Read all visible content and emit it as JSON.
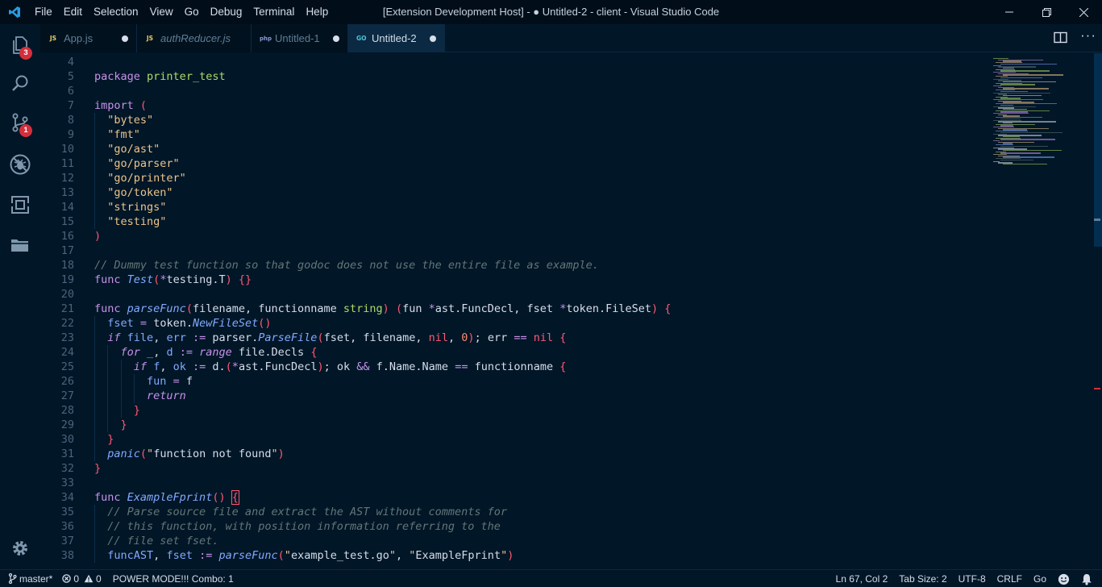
{
  "window": {
    "title": "[Extension Development Host] - ● Untitled-2 - client - Visual Studio Code",
    "menu": [
      "File",
      "Edit",
      "Selection",
      "View",
      "Go",
      "Debug",
      "Terminal",
      "Help"
    ]
  },
  "activity_bar": {
    "items": [
      {
        "name": "explorer-icon",
        "badge": "3"
      },
      {
        "name": "search-icon",
        "badge": ""
      },
      {
        "name": "source-control-icon",
        "badge": "1"
      },
      {
        "name": "debug-icon",
        "badge": ""
      },
      {
        "name": "extensions-icon",
        "badge": ""
      },
      {
        "name": "folders-icon",
        "badge": ""
      }
    ],
    "manage_icon": "gear-icon"
  },
  "tabs": [
    {
      "label": "App.js",
      "icon": "JS",
      "icon_color": "#e6cd69",
      "italic": false,
      "active": false,
      "dirty": true
    },
    {
      "label": "authReducer.js",
      "icon": "JS",
      "icon_color": "#e6cd69",
      "italic": true,
      "active": false,
      "dirty": false
    },
    {
      "label": "Untitled-1",
      "icon": "php",
      "icon_color": "#8a9ad6",
      "italic": false,
      "active": false,
      "dirty": true
    },
    {
      "label": "Untitled-2",
      "icon": "GO",
      "icon_color": "#4fc1d9",
      "italic": false,
      "active": true,
      "dirty": true
    }
  ],
  "editor": {
    "language": "Go",
    "lines": [
      {
        "n": "4",
        "indent": 0,
        "tokens": []
      },
      {
        "n": "5",
        "indent": 0,
        "tokens": [
          [
            "kw",
            "package"
          ],
          [
            "var",
            " "
          ],
          [
            "pkg",
            "printer_test"
          ]
        ]
      },
      {
        "n": "6",
        "indent": 0,
        "tokens": []
      },
      {
        "n": "7",
        "indent": 0,
        "tokens": [
          [
            "kw",
            "import"
          ],
          [
            "var",
            " "
          ],
          [
            "br",
            "("
          ]
        ]
      },
      {
        "n": "8",
        "indent": 1,
        "tokens": [
          [
            "str",
            "  \"bytes\""
          ]
        ]
      },
      {
        "n": "9",
        "indent": 1,
        "tokens": [
          [
            "str",
            "  \"fmt\""
          ]
        ]
      },
      {
        "n": "10",
        "indent": 1,
        "tokens": [
          [
            "str",
            "  \"go/ast\""
          ]
        ]
      },
      {
        "n": "11",
        "indent": 1,
        "tokens": [
          [
            "str",
            "  \"go/parser\""
          ]
        ]
      },
      {
        "n": "12",
        "indent": 1,
        "tokens": [
          [
            "str",
            "  \"go/printer\""
          ]
        ]
      },
      {
        "n": "13",
        "indent": 1,
        "tokens": [
          [
            "str",
            "  \"go/token\""
          ]
        ]
      },
      {
        "n": "14",
        "indent": 1,
        "tokens": [
          [
            "str",
            "  \"strings\""
          ]
        ]
      },
      {
        "n": "15",
        "indent": 1,
        "tokens": [
          [
            "str",
            "  \"testing\""
          ]
        ]
      },
      {
        "n": "16",
        "indent": 0,
        "tokens": [
          [
            "br",
            ")"
          ]
        ]
      },
      {
        "n": "17",
        "indent": 0,
        "tokens": []
      },
      {
        "n": "18",
        "indent": 0,
        "tokens": [
          [
            "cm",
            "// Dummy test function so that godoc does not use the entire file as example."
          ]
        ]
      },
      {
        "n": "19",
        "indent": 0,
        "tokens": [
          [
            "kw",
            "func"
          ],
          [
            "var",
            " "
          ],
          [
            "fn",
            "Test"
          ],
          [
            "br",
            "("
          ],
          [
            "op",
            "*"
          ],
          [
            "var",
            "testing.T"
          ],
          [
            "br",
            ")"
          ],
          [
            "var",
            " "
          ],
          [
            "br",
            "{}"
          ]
        ]
      },
      {
        "n": "20",
        "indent": 0,
        "tokens": []
      },
      {
        "n": "21",
        "indent": 0,
        "tokens": [
          [
            "kw",
            "func"
          ],
          [
            "var",
            " "
          ],
          [
            "fn",
            "parseFunc"
          ],
          [
            "br",
            "("
          ],
          [
            "var",
            "filename, functionname "
          ],
          [
            "type",
            "string"
          ],
          [
            "br",
            ")"
          ],
          [
            "var",
            " "
          ],
          [
            "br",
            "("
          ],
          [
            "var",
            "fun "
          ],
          [
            "op",
            "*"
          ],
          [
            "var",
            "ast.FuncDecl, fset "
          ],
          [
            "op",
            "*"
          ],
          [
            "var",
            "token.FileSet"
          ],
          [
            "br",
            ")"
          ],
          [
            "var",
            " "
          ],
          [
            "br",
            "{"
          ]
        ]
      },
      {
        "n": "22",
        "indent": 1,
        "tokens": [
          [
            "var",
            "  "
          ],
          [
            "fnn",
            "fset"
          ],
          [
            "var",
            " "
          ],
          [
            "op",
            "="
          ],
          [
            "var",
            " token."
          ],
          [
            "fn",
            "NewFileSet"
          ],
          [
            "br",
            "()"
          ]
        ]
      },
      {
        "n": "23",
        "indent": 1,
        "tokens": [
          [
            "var",
            "  "
          ],
          [
            "ctrl",
            "if"
          ],
          [
            "var",
            " "
          ],
          [
            "fnn",
            "file"
          ],
          [
            "var",
            ", "
          ],
          [
            "fnn",
            "err"
          ],
          [
            "var",
            " "
          ],
          [
            "op",
            ":="
          ],
          [
            "var",
            " parser."
          ],
          [
            "fn",
            "ParseFile"
          ],
          [
            "br",
            "("
          ],
          [
            "var",
            "fset, filename, "
          ],
          [
            "const",
            "nil"
          ],
          [
            "var",
            ", "
          ],
          [
            "num",
            "0"
          ],
          [
            "br",
            ")"
          ],
          [
            "var",
            "; err "
          ],
          [
            "op",
            "=="
          ],
          [
            "var",
            " "
          ],
          [
            "const",
            "nil"
          ],
          [
            "var",
            " "
          ],
          [
            "br",
            "{"
          ]
        ]
      },
      {
        "n": "24",
        "indent": 2,
        "tokens": [
          [
            "var",
            "    "
          ],
          [
            "ctrl",
            "for"
          ],
          [
            "var",
            " "
          ],
          [
            "fnn",
            "_"
          ],
          [
            "var",
            ", "
          ],
          [
            "fnn",
            "d"
          ],
          [
            "var",
            " "
          ],
          [
            "op",
            ":="
          ],
          [
            "var",
            " "
          ],
          [
            "ctrl",
            "range"
          ],
          [
            "var",
            " file.Decls "
          ],
          [
            "br",
            "{"
          ]
        ]
      },
      {
        "n": "25",
        "indent": 3,
        "tokens": [
          [
            "var",
            "      "
          ],
          [
            "ctrl",
            "if"
          ],
          [
            "var",
            " "
          ],
          [
            "fnn",
            "f"
          ],
          [
            "var",
            ", "
          ],
          [
            "fnn",
            "ok"
          ],
          [
            "var",
            " "
          ],
          [
            "op",
            ":="
          ],
          [
            "var",
            " d."
          ],
          [
            "br",
            "("
          ],
          [
            "op",
            "*"
          ],
          [
            "var",
            "ast.FuncDecl"
          ],
          [
            "br",
            ")"
          ],
          [
            "var",
            "; ok "
          ],
          [
            "op",
            "&&"
          ],
          [
            "var",
            " f.Name.Name "
          ],
          [
            "op",
            "=="
          ],
          [
            "var",
            " functionname "
          ],
          [
            "br",
            "{"
          ]
        ]
      },
      {
        "n": "26",
        "indent": 4,
        "tokens": [
          [
            "var",
            "        "
          ],
          [
            "fnn",
            "fun"
          ],
          [
            "var",
            " "
          ],
          [
            "op",
            "="
          ],
          [
            "var",
            " f"
          ]
        ]
      },
      {
        "n": "27",
        "indent": 4,
        "tokens": [
          [
            "var",
            "        "
          ],
          [
            "ctrl",
            "return"
          ]
        ]
      },
      {
        "n": "28",
        "indent": 3,
        "tokens": [
          [
            "var",
            "      "
          ],
          [
            "br",
            "}"
          ]
        ]
      },
      {
        "n": "29",
        "indent": 2,
        "tokens": [
          [
            "var",
            "    "
          ],
          [
            "br",
            "}"
          ]
        ]
      },
      {
        "n": "30",
        "indent": 1,
        "tokens": [
          [
            "var",
            "  "
          ],
          [
            "br",
            "}"
          ]
        ]
      },
      {
        "n": "31",
        "indent": 1,
        "tokens": [
          [
            "var",
            "  "
          ],
          [
            "fn",
            "panic"
          ],
          [
            "br",
            "("
          ],
          [
            "str",
            "\""
          ],
          [
            "var",
            "function not found"
          ],
          [
            "str",
            "\""
          ],
          [
            "br",
            ")"
          ]
        ]
      },
      {
        "n": "32",
        "indent": 0,
        "tokens": [
          [
            "br",
            "}"
          ]
        ]
      },
      {
        "n": "33",
        "indent": 0,
        "tokens": []
      },
      {
        "n": "34",
        "indent": 0,
        "tokens": [
          [
            "kw",
            "func"
          ],
          [
            "var",
            " "
          ],
          [
            "fn",
            "ExampleFprint"
          ],
          [
            "br",
            "()"
          ],
          [
            "var",
            " "
          ],
          [
            "brc",
            "{"
          ]
        ]
      },
      {
        "n": "35",
        "indent": 1,
        "tokens": [
          [
            "cm",
            "  // Parse source file and extract the AST without comments for"
          ]
        ]
      },
      {
        "n": "36",
        "indent": 1,
        "tokens": [
          [
            "cm",
            "  // this function, with position information referring to the"
          ]
        ]
      },
      {
        "n": "37",
        "indent": 1,
        "tokens": [
          [
            "cm",
            "  // file set fset."
          ]
        ]
      },
      {
        "n": "38",
        "indent": 1,
        "tokens": [
          [
            "var",
            "  "
          ],
          [
            "fnn",
            "funcAST"
          ],
          [
            "var",
            ", "
          ],
          [
            "fnn",
            "fset"
          ],
          [
            "var",
            " "
          ],
          [
            "op",
            ":="
          ],
          [
            "var",
            " "
          ],
          [
            "fn",
            "parseFunc"
          ],
          [
            "br",
            "("
          ],
          [
            "str",
            "\""
          ],
          [
            "var",
            "example_test.go"
          ],
          [
            "str",
            "\""
          ],
          [
            "var",
            ", "
          ],
          [
            "str",
            "\""
          ],
          [
            "var",
            "ExampleFprint"
          ],
          [
            "str",
            "\""
          ],
          [
            "br",
            ")"
          ]
        ]
      }
    ]
  },
  "status_bar": {
    "branch": "master*",
    "errors": "0",
    "warnings": "0",
    "power_mode": "POWER MODE!!! Combo: 1",
    "position": "Ln 67, Col 2",
    "tab_size": "Tab Size: 2",
    "encoding": "UTF-8",
    "eol": "CRLF",
    "language": "Go"
  },
  "colors": {
    "background": "#011627",
    "accent": "#d42f3c",
    "keyword": "#c792ea",
    "string": "#ecc48d",
    "function": "#82aaff",
    "comment": "#637777",
    "bracket": "#ff5874"
  }
}
